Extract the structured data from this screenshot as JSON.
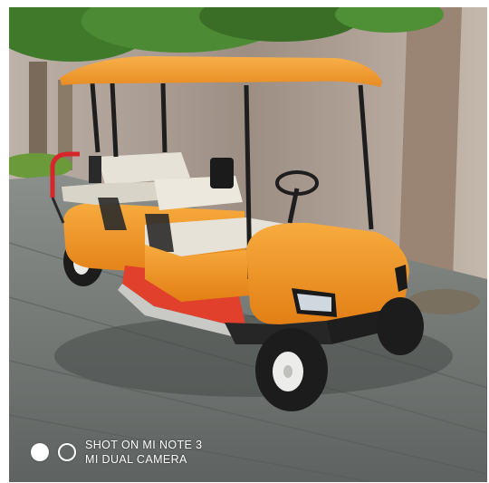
{
  "image": {
    "subject": "golf-cart",
    "colors": {
      "body": "#f29a2a",
      "canopy": "#f5a43a",
      "floor": "#e0402c",
      "seat": "#e6e2d8",
      "wall": "#a8978c",
      "pavement": "#6f7472",
      "foliage": "#3f7a2a"
    }
  },
  "watermark": {
    "line1": "SHOT ON MI NOTE 3",
    "line2": "MI DUAL CAMERA",
    "icon_names": [
      "filled-circle-icon",
      "ring-icon"
    ]
  }
}
